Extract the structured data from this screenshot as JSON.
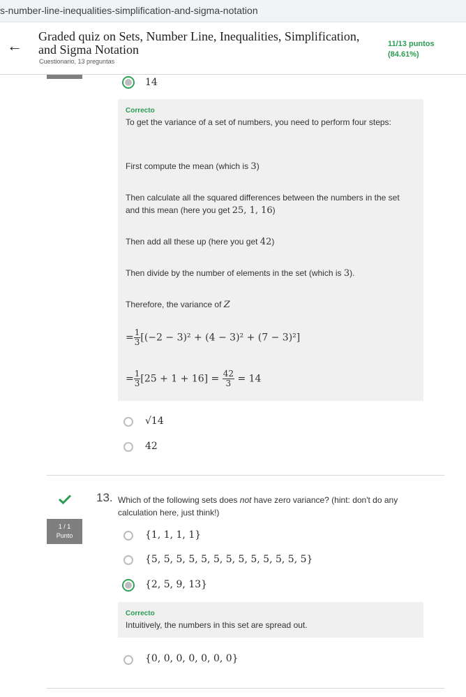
{
  "browser": {
    "url": "s-number-line-inequalities-simplification-and-sigma-notation"
  },
  "header": {
    "back_label": "←",
    "title": "Graded quiz on Sets, Number Line, Inequalities, Simplification, and Sigma Notation",
    "subtitle": "Cuestionario, 13 preguntas",
    "score_line1": "11/13 puntos",
    "score_line2": "(84.61%)"
  },
  "q12": {
    "selected_option": "14",
    "feedback_status": "Correcto",
    "feedback": {
      "p1": "To get the variance of a set of numbers, you need to perform four steps:",
      "p2_pre": "First compute the mean (which is ",
      "p2_math": "3",
      "p2_post": ")",
      "p3_pre": "Then calculate all the squared differences between the numbers in the set and this mean (here you get ",
      "p3_math": "25, 1, 16",
      "p3_post": ")",
      "p4_pre": "Then add all these up (here you get ",
      "p4_math": "42",
      "p4_post": ")",
      "p5_pre": "Then divide by the number of elements in the set (which is ",
      "p5_math": "3",
      "p5_post": ").",
      "p6_pre": "Therefore, the variance of ",
      "p6_math": "Z",
      "f1_eq": "=",
      "f1_num": "1",
      "f1_den": "3",
      "f1_rest": "[(−2 − 3)² + (4 − 3)² + (7 − 3)²]",
      "f2_eq": "=",
      "f2_num": "1",
      "f2_den": "3",
      "f2_mid": "[25 + 1 + 16] =",
      "f2_num2": "42",
      "f2_den2": "3",
      "f2_end": "= 14"
    },
    "other_options": [
      "√14",
      "42"
    ]
  },
  "q13": {
    "number": "13.",
    "points_line1": "1 / 1",
    "points_line2": "Punto",
    "question_pre": "Which of the following sets does ",
    "question_em": "not",
    "question_post": " have zero variance? (hint: don't do any calculation here, just think!)",
    "options": [
      "{1, 1, 1, 1}",
      "{5, 5, 5, 5, 5, 5, 5, 5, 5, 5, 5, 5, 5}",
      "{2, 5, 9, 13}",
      "{0, 0, 0, 0, 0, 0, 0}"
    ],
    "feedback_status": "Correcto",
    "feedback": "Intuitively, the numbers in this set are spread out."
  },
  "colors": {
    "correct": "#2a9d52",
    "feedback_bg": "#f0f0f0",
    "points_badge": "#7f7f7f"
  },
  "icons": {
    "back": "arrow-left-icon",
    "correct": "checkmark-icon"
  }
}
